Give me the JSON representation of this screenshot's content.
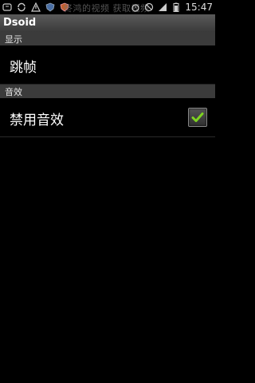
{
  "status_bar": {
    "time": "15:47",
    "notification_text": "佟鸿的视频  获取视频",
    "icons": [
      "android-debug-icon",
      "sync-icon",
      "warning-icon",
      "shield-icon",
      "app-icon",
      "alarm-icon",
      "no-signal-icon",
      "signal-icon",
      "battery-icon"
    ]
  },
  "app": {
    "title": "Dsoid"
  },
  "sections": [
    {
      "header": "显示",
      "items": [
        {
          "label": "跳帧"
        }
      ]
    },
    {
      "header": "音效",
      "items": [
        {
          "label": "禁用音效",
          "checked": true
        }
      ]
    }
  ],
  "colors": {
    "accent_check": "#7ed321",
    "section_bg": "#3b3b3b",
    "background": "#000000"
  }
}
